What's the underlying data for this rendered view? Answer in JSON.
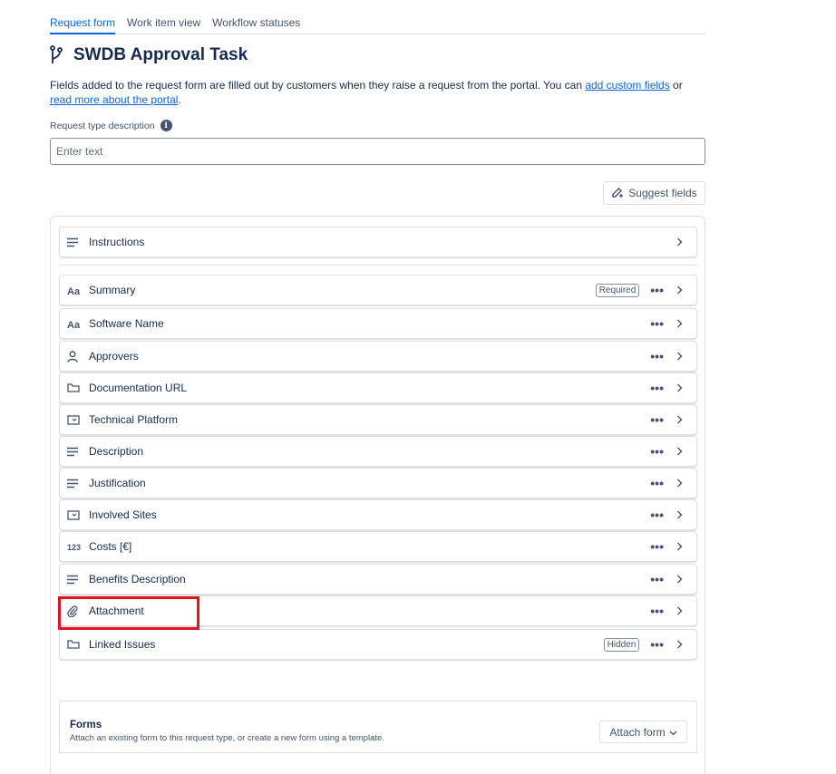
{
  "tabs": [
    {
      "label": "Request form",
      "active": true
    },
    {
      "label": "Work item view",
      "active": false
    },
    {
      "label": "Workflow statuses",
      "active": false
    }
  ],
  "page": {
    "title": "SWDB Approval Task",
    "title_icon": "branch-icon",
    "description_prefix": "Fields added to the request form are filled out by customers when they raise a request from the portal. You can ",
    "link_custom_fields": "add custom fields",
    "description_mid": " or ",
    "link_read_more": "read more about the portal",
    "description_suffix": "."
  },
  "request_type_description": {
    "label": "Request type description",
    "placeholder": "Enter text",
    "value": ""
  },
  "suggest_button": {
    "label": "Suggest fields",
    "icon": "magic-pen-icon"
  },
  "instructions_row": {
    "label": "Instructions",
    "icon": "paragraph-icon"
  },
  "fields": [
    {
      "label": "Summary",
      "icon": "text-aa-icon",
      "badge": "Required"
    },
    {
      "label": "Software Name",
      "icon": "text-aa-icon",
      "badge": ""
    },
    {
      "label": "Approvers",
      "icon": "person-icon",
      "badge": ""
    },
    {
      "label": "Documentation URL",
      "icon": "url-field-icon",
      "badge": ""
    },
    {
      "label": "Technical Platform",
      "icon": "select-list-icon",
      "badge": ""
    },
    {
      "label": "Description",
      "icon": "paragraph-icon",
      "badge": ""
    },
    {
      "label": "Justification",
      "icon": "paragraph-icon",
      "badge": ""
    },
    {
      "label": "Involved Sites",
      "icon": "select-list-icon",
      "badge": ""
    },
    {
      "label": "Costs [€]",
      "icon": "number-123-icon",
      "badge": ""
    },
    {
      "label": "Benefits Description",
      "icon": "paragraph-icon",
      "badge": ""
    },
    {
      "label": "Attachment",
      "icon": "paperclip-icon",
      "badge": ""
    },
    {
      "label": "Linked Issues",
      "icon": "url-field-icon",
      "badge": "Hidden"
    }
  ],
  "more_glyph": "•••",
  "forms": {
    "title": "Forms",
    "subtitle": "Attach an existing form to this request type, or create a new form using a template.",
    "button_label": "Attach form"
  },
  "colors": {
    "accent": "#0c66e4",
    "highlight": "#e2151b",
    "text": "#172b4d",
    "subtle": "#44546f"
  }
}
